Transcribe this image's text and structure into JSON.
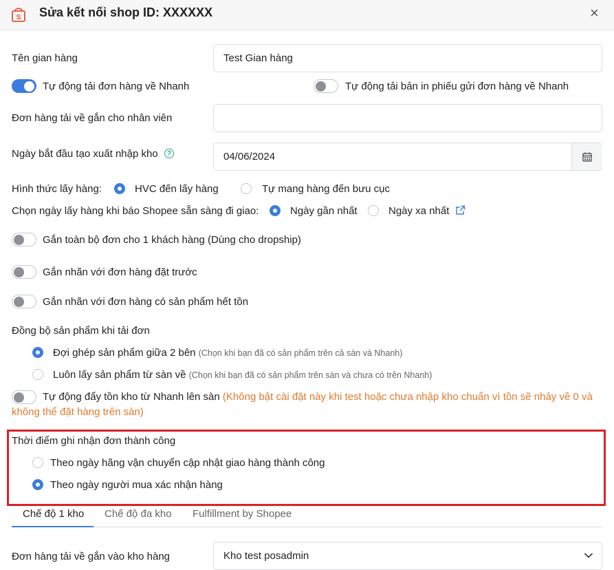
{
  "dialog": {
    "title": "Sửa kết nối shop ID: XXXXXX",
    "close_icon": "×"
  },
  "store_name": {
    "label": "Tên gian hàng",
    "value": "Test Gian hàng"
  },
  "auto_download": {
    "label": "Tự động tải đơn hàng về Nhanh",
    "on": true
  },
  "auto_print": {
    "label": "Tự động tải bản in phiếu gửi đơn hàng về Nhanh",
    "on": false
  },
  "assign_staff": {
    "label": "Đơn hàng tải về gắn cho nhân viên",
    "value": ""
  },
  "start_date": {
    "label": "Ngày bắt đầu tạo xuất nhập kho",
    "value": "04/06/2024",
    "help": "?"
  },
  "pickup": {
    "label": "Hình thức lấy hàng:",
    "options": [
      "HVC đến lấy hàng",
      "Tự mang hàng đến bưu cục"
    ],
    "selected": 0
  },
  "pickup_date": {
    "label": "Chọn ngày lấy hàng khi báo Shopee sẵn sàng đi giao:",
    "options": [
      "Ngày gần nhất",
      "Ngày xa nhất"
    ],
    "selected": 0
  },
  "toggles": [
    {
      "label": "Gắn toàn bộ đơn cho 1 khách hàng (Dùng cho dropship)",
      "on": false
    },
    {
      "label": "Gắn nhãn với đơn hàng đặt trước",
      "on": false
    },
    {
      "label": "Gắn nhãn với đơn hàng có sản phẩm hết tồn",
      "on": false
    }
  ],
  "sync_products": {
    "label": "Đồng bộ sản phẩm khi tải đơn",
    "options": [
      {
        "label": "Đợi ghép sản phẩm giữa 2 bên",
        "hint": "(Chọn khi bạn đã có sản phẩm trên cả sàn và Nhanh)"
      },
      {
        "label": "Luôn lấy sản phẩm từ sàn về",
        "hint": "(Chọn khi bạn đã có sản phẩm trên sàn và chưa có trên Nhanh)"
      }
    ],
    "selected": 0
  },
  "push_stock": {
    "label": "Tự động đẩy tồn kho từ Nhanh lên sàn",
    "warning_line1": "(Không bật cài đặt này khi test hoặc chưa nhập kho chuẩn vì tồn sẽ nhảy về 0 và",
    "warning_line2": "không thể đặt hàng trên sàn)",
    "on": false
  },
  "success_time": {
    "label": "Thời điểm ghi nhận đơn thành công",
    "options": [
      "Theo ngày hãng vận chuyển cập nhật giao hàng thành công",
      "Theo ngày người mua xác nhận hàng"
    ],
    "selected": 1
  },
  "tabs": [
    "Chế độ 1 kho",
    "Chế độ đa kho",
    "Fulfillment by Shopee"
  ],
  "active_tab": 0,
  "warehouse": {
    "label": "Đơn hàng tải về gắn vào kho hàng",
    "value": "Kho test posadmin"
  },
  "colors": {
    "accent": "#3b7ddd",
    "brand": "#ee4d2d",
    "warning": "#e07a2e",
    "highlight": "#d9222a"
  }
}
